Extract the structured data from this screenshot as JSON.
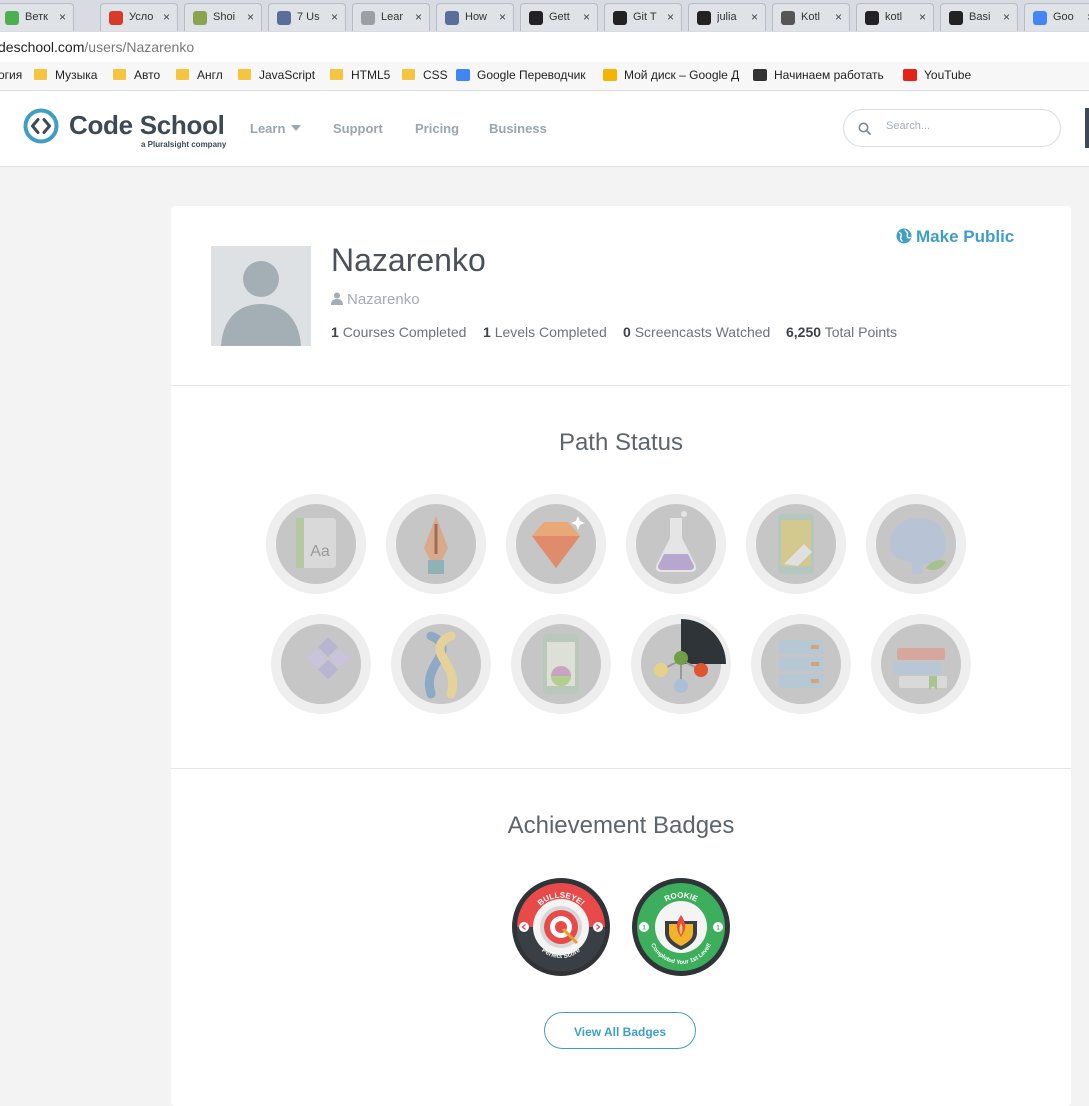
{
  "browser": {
    "tabs": [
      {
        "label": "Ветк",
        "icon": "green-circle-icon",
        "color": "#4caf50"
      },
      {
        "label": "Усло",
        "icon": "red-figure-icon",
        "color": "#d93b2b"
      },
      {
        "label": "Shoi",
        "icon": "green-box-icon",
        "color": "#8aa34f"
      },
      {
        "label": "7 Us",
        "icon": "fx-icon",
        "color": "#5a6e9a"
      },
      {
        "label": "Lear",
        "icon": "document-icon",
        "color": "#9aa0a6"
      },
      {
        "label": "How",
        "icon": "fx-icon",
        "color": "#5a6e9a"
      },
      {
        "label": "Gett",
        "icon": "github-icon",
        "color": "#222222"
      },
      {
        "label": "Git T",
        "icon": "github-icon",
        "color": "#222222"
      },
      {
        "label": "julia",
        "icon": "github-icon",
        "color": "#222222"
      },
      {
        "label": "Kotl",
        "icon": "kotlin-icon",
        "color": "#555555"
      },
      {
        "label": "kotl",
        "icon": "github-icon",
        "color": "#222222"
      },
      {
        "label": "Basi",
        "icon": "github-icon",
        "color": "#222222"
      },
      {
        "label": "Goo",
        "icon": "google-translate-icon",
        "color": "#4285f4"
      }
    ],
    "tab_close": "×",
    "address_host": "deschool.com",
    "address_path": "/users/Nazarenko",
    "bookmarks": [
      {
        "label": "огия",
        "type": "text"
      },
      {
        "label": "Музыка",
        "type": "folder"
      },
      {
        "label": "Авто",
        "type": "folder"
      },
      {
        "label": "Англ",
        "type": "folder"
      },
      {
        "label": "JavaScript",
        "type": "folder"
      },
      {
        "label": "HTML5",
        "type": "folder"
      },
      {
        "label": "CSS",
        "type": "folder"
      },
      {
        "label": "Google Переводчик",
        "type": "google-translate-icon"
      },
      {
        "label": "Мой диск – Google Д",
        "type": "google-drive-icon"
      },
      {
        "label": "Начинаем работать",
        "type": "ht-icon"
      },
      {
        "label": "YouTube",
        "type": "youtube-icon"
      }
    ]
  },
  "site": {
    "logo_text": "Code School",
    "logo_sub": "a Pluralsight company",
    "nav": [
      "Learn",
      "Support",
      "Pricing",
      "Business"
    ],
    "search_placeholder": "Search...",
    "accent": "#3f9fc3"
  },
  "profile": {
    "name": "Nazarenko",
    "username": "Nazarenko",
    "make_public": "Make Public",
    "stats": [
      {
        "value": "1",
        "label": "Courses Completed"
      },
      {
        "value": "1",
        "label": "Levels Completed"
      },
      {
        "value": "0",
        "label": "Screencasts Watched"
      },
      {
        "value": "6,250",
        "label": "Total Points"
      }
    ]
  },
  "path_status": {
    "title": "Path Status",
    "paths": [
      {
        "icon": "html-css-path-icon",
        "progress": 0
      },
      {
        "icon": "javascript-pen-path-icon",
        "progress": 0
      },
      {
        "icon": "ruby-gem-path-icon",
        "progress": 0
      },
      {
        "icon": "flask-python-path-icon",
        "progress": 0
      },
      {
        "icon": "ios-phone-path-icon",
        "progress": 0
      },
      {
        "icon": "php-elephant-path-icon",
        "progress": 0
      },
      {
        "icon": "dotnet-diamond-path-icon",
        "progress": 0
      },
      {
        "icon": "python-snakes-path-icon",
        "progress": 0
      },
      {
        "icon": "android-phone-path-icon",
        "progress": 0
      },
      {
        "icon": "git-network-path-icon",
        "progress": 0.25
      },
      {
        "icon": "database-server-path-icon",
        "progress": 0
      },
      {
        "icon": "electives-books-path-icon",
        "progress": 0
      }
    ]
  },
  "achievements": {
    "title": "Achievement Badges",
    "badges": [
      {
        "top": "BULLSEYE!",
        "bottom": "Perfect Score",
        "color": "#e84a4a",
        "icon": "bullseye-icon"
      },
      {
        "top": "ROOKIE",
        "bottom": "Completed Your 1st Level!",
        "color": "#3dae5c",
        "icon": "rookie-crest-icon"
      }
    ],
    "view_all": "View All Badges"
  }
}
